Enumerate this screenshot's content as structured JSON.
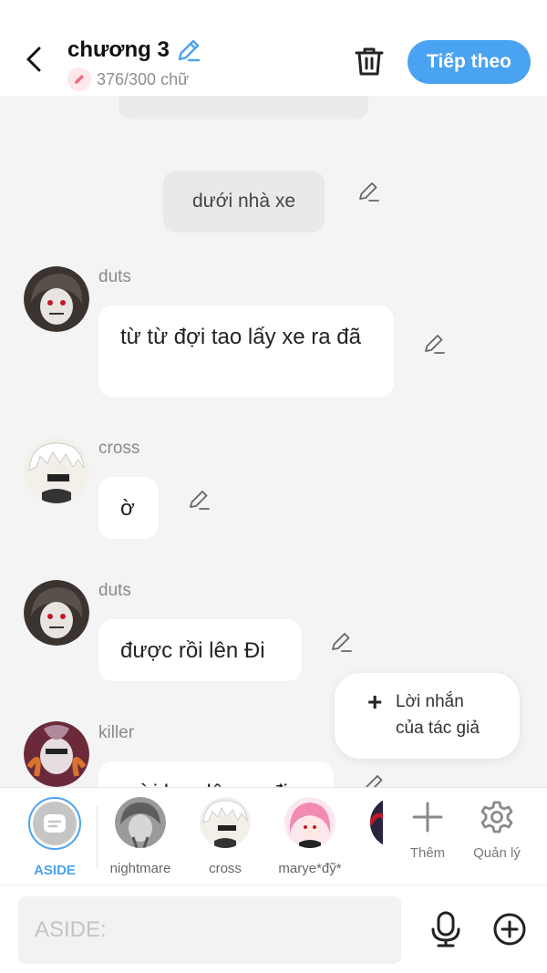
{
  "header": {
    "title": "chương 3",
    "word_count": "376/300 chữ",
    "next_label": "Tiếp theo",
    "accent_color": "#4aa3f0",
    "count_badge_color": "#f06a7e"
  },
  "messages": {
    "narration": "dưới nhà xe",
    "m1": {
      "name": "duts",
      "text": "từ từ đợi tao lấy xe ra đã"
    },
    "m2": {
      "name": "cross",
      "text": "ờ"
    },
    "m3": {
      "name": "duts",
      "text": "được rồi lên Đi"
    },
    "m4": {
      "name": "killer",
      "text": "mời bạn lên xe đi"
    }
  },
  "author_note": {
    "line1": "Lời nhắn",
    "line2": "của tác giả"
  },
  "characters": [
    {
      "label": "ASIDE",
      "selected": true
    },
    {
      "label": "nightmare"
    },
    {
      "label": "cross"
    },
    {
      "label": "marye*đỹ*"
    }
  ],
  "tools": {
    "add_label": "Thêm",
    "manage_label": "Quản lý"
  },
  "input": {
    "placeholder": "ASIDE:",
    "value": ""
  }
}
